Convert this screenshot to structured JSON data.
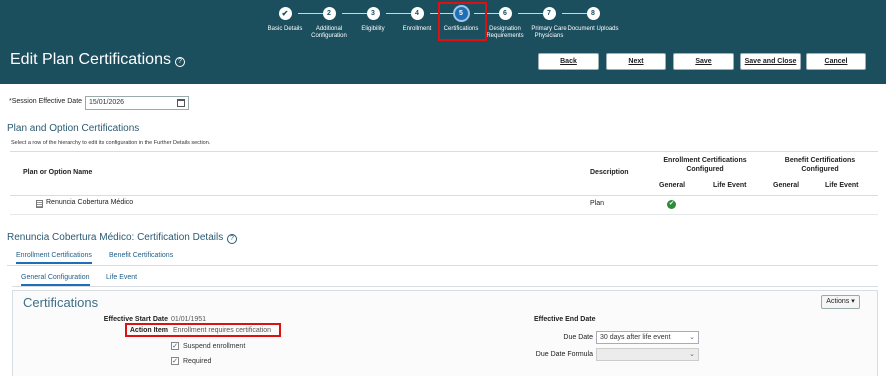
{
  "train": {
    "steps": [
      {
        "num": "✔",
        "label": "Basic Details",
        "state": "done"
      },
      {
        "num": "2",
        "label": "Additional Configuration",
        "state": "todo"
      },
      {
        "num": "3",
        "label": "Eligibility",
        "state": "todo"
      },
      {
        "num": "4",
        "label": "Enrollment",
        "state": "todo"
      },
      {
        "num": "5",
        "label": "Certifications",
        "state": "active"
      },
      {
        "num": "6",
        "label": "Designation Requirements",
        "state": "todo"
      },
      {
        "num": "7",
        "label": "Primary Care Physicians",
        "state": "todo"
      },
      {
        "num": "8",
        "label": "Document Uploads",
        "state": "todo"
      }
    ]
  },
  "header": {
    "title": "Edit Plan Certifications",
    "help": "?",
    "buttons": {
      "back": "Back",
      "next": "Next",
      "save": "Save",
      "save_close": "Save and Close",
      "cancel": "Cancel"
    }
  },
  "session": {
    "label": "Session Effective Date",
    "required_mark": "*",
    "value": "15/01/2026"
  },
  "plans": {
    "title": "Plan and Option Certifications",
    "hint": "Select a row of the hierarchy to edit its configuration in the Further Details section.",
    "columns": {
      "name": "Plan or Option Name",
      "description": "Description",
      "enrollment_group": "Enrollment Certifications Configured",
      "benefit_group": "Benefit Certifications Configured",
      "general": "General",
      "life_event": "Life Event"
    },
    "rows": [
      {
        "name": "Renuncia Cobertura Médico",
        "description": "Plan",
        "enrollment_general": "✔"
      }
    ]
  },
  "details": {
    "title": "Renuncia Cobertura Médico: Certification Details",
    "tabs": [
      "Enrollment Certifications",
      "Benefit Certifications"
    ],
    "subtabs": [
      "General Configuration",
      "Life Event"
    ],
    "panel_title": "Certifications",
    "actions": "Actions",
    "fields": {
      "effective_start_label": "Effective Start Date",
      "effective_start_value": "01/01/1951",
      "action_item_label": "Action Item",
      "action_item_value": "Enrollment requires certification",
      "suspend_label": "Suspend enrollment",
      "required_label": "Required",
      "effective_end_label": "Effective End Date",
      "due_date_label": "Due Date",
      "due_date_value": "30 days after life event",
      "due_formula_label": "Due Date Formula"
    }
  }
}
